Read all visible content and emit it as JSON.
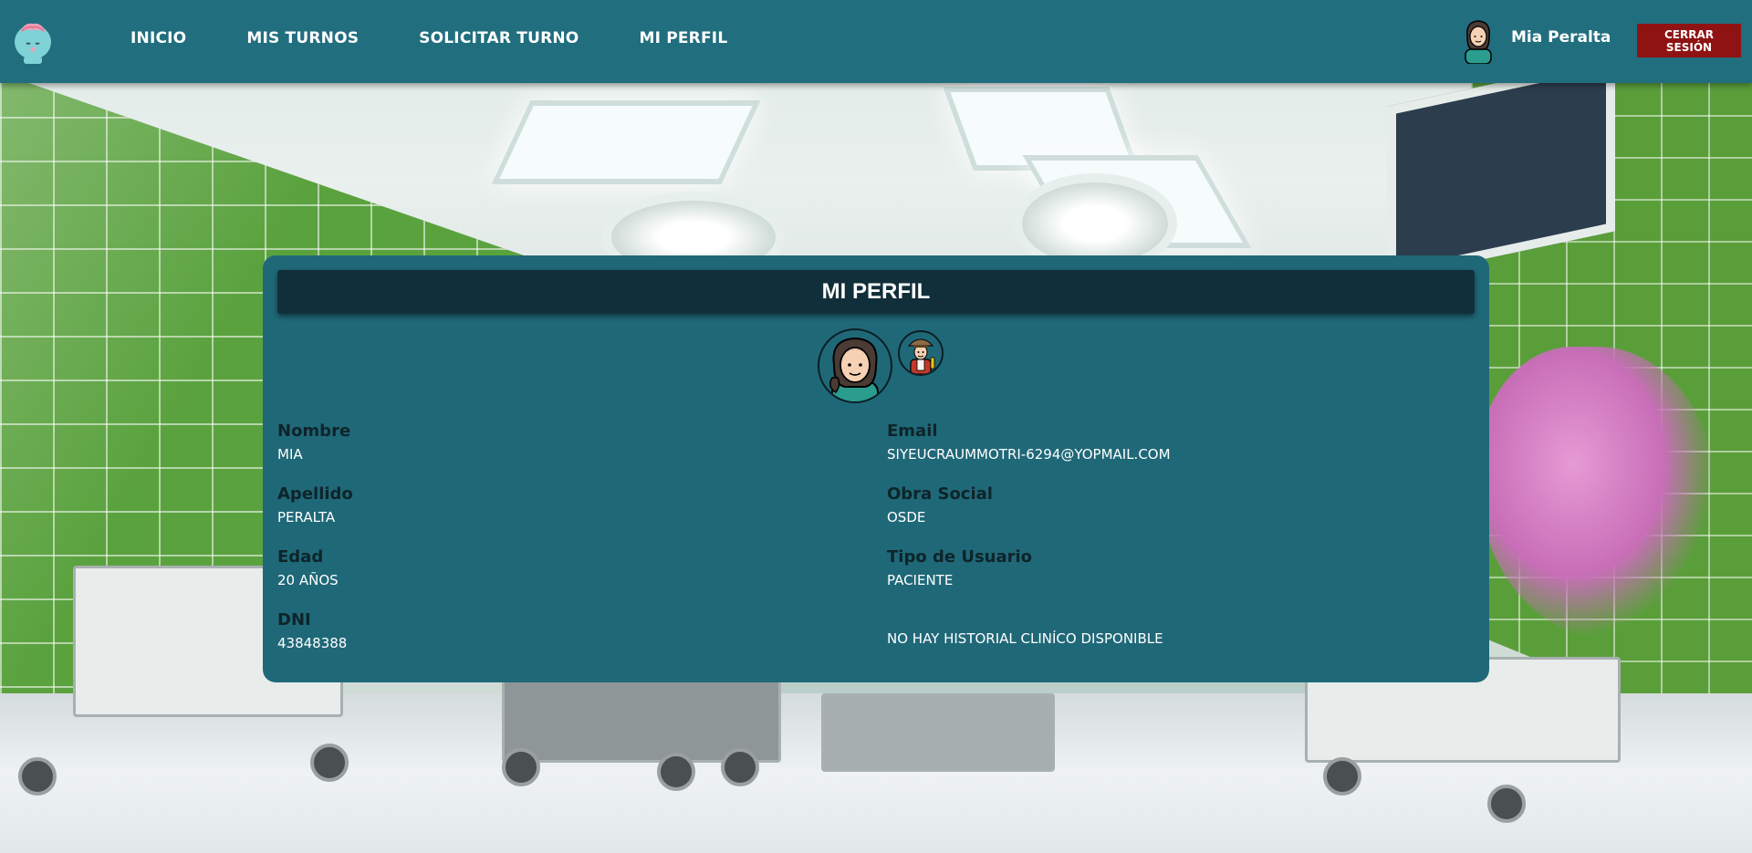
{
  "navbar": {
    "links": [
      "INICIO",
      "MIS TURNOS",
      "SOLICITAR TURNO",
      "MI PERFIL"
    ],
    "user_name": "Mia Peralta",
    "logout_label": "CERRAR SESIÓN",
    "logo_icon": "brain-mascot-icon",
    "avatar_icon": "woman-avatar-icon"
  },
  "card": {
    "title": "MI PERFIL",
    "photos": [
      "woman-avatar-icon",
      "explorer-avatar-icon"
    ],
    "fields": {
      "nombre": {
        "label": "Nombre",
        "value": "MIA"
      },
      "apellido": {
        "label": "Apellido",
        "value": "PERALTA"
      },
      "edad": {
        "label": "Edad",
        "value": "20 AÑOS"
      },
      "dni": {
        "label": "DNI",
        "value": "43848388"
      },
      "email": {
        "label": "Email",
        "value": "SIYEUCRAUMMOTRI-6294@YOPMAIL.COM"
      },
      "obra_social": {
        "label": "Obra Social",
        "value": "OSDE"
      },
      "tipo_usuario": {
        "label": "Tipo de Usuario",
        "value": "PACIENTE"
      },
      "historial": {
        "value": "NO HAY HISTORIAL CLINÍCO DISPONIBLE"
      }
    }
  },
  "colors": {
    "navbar": "#216e7e",
    "card": "#1f6878",
    "card_header": "#112f3a",
    "logout": "#8f1313"
  }
}
